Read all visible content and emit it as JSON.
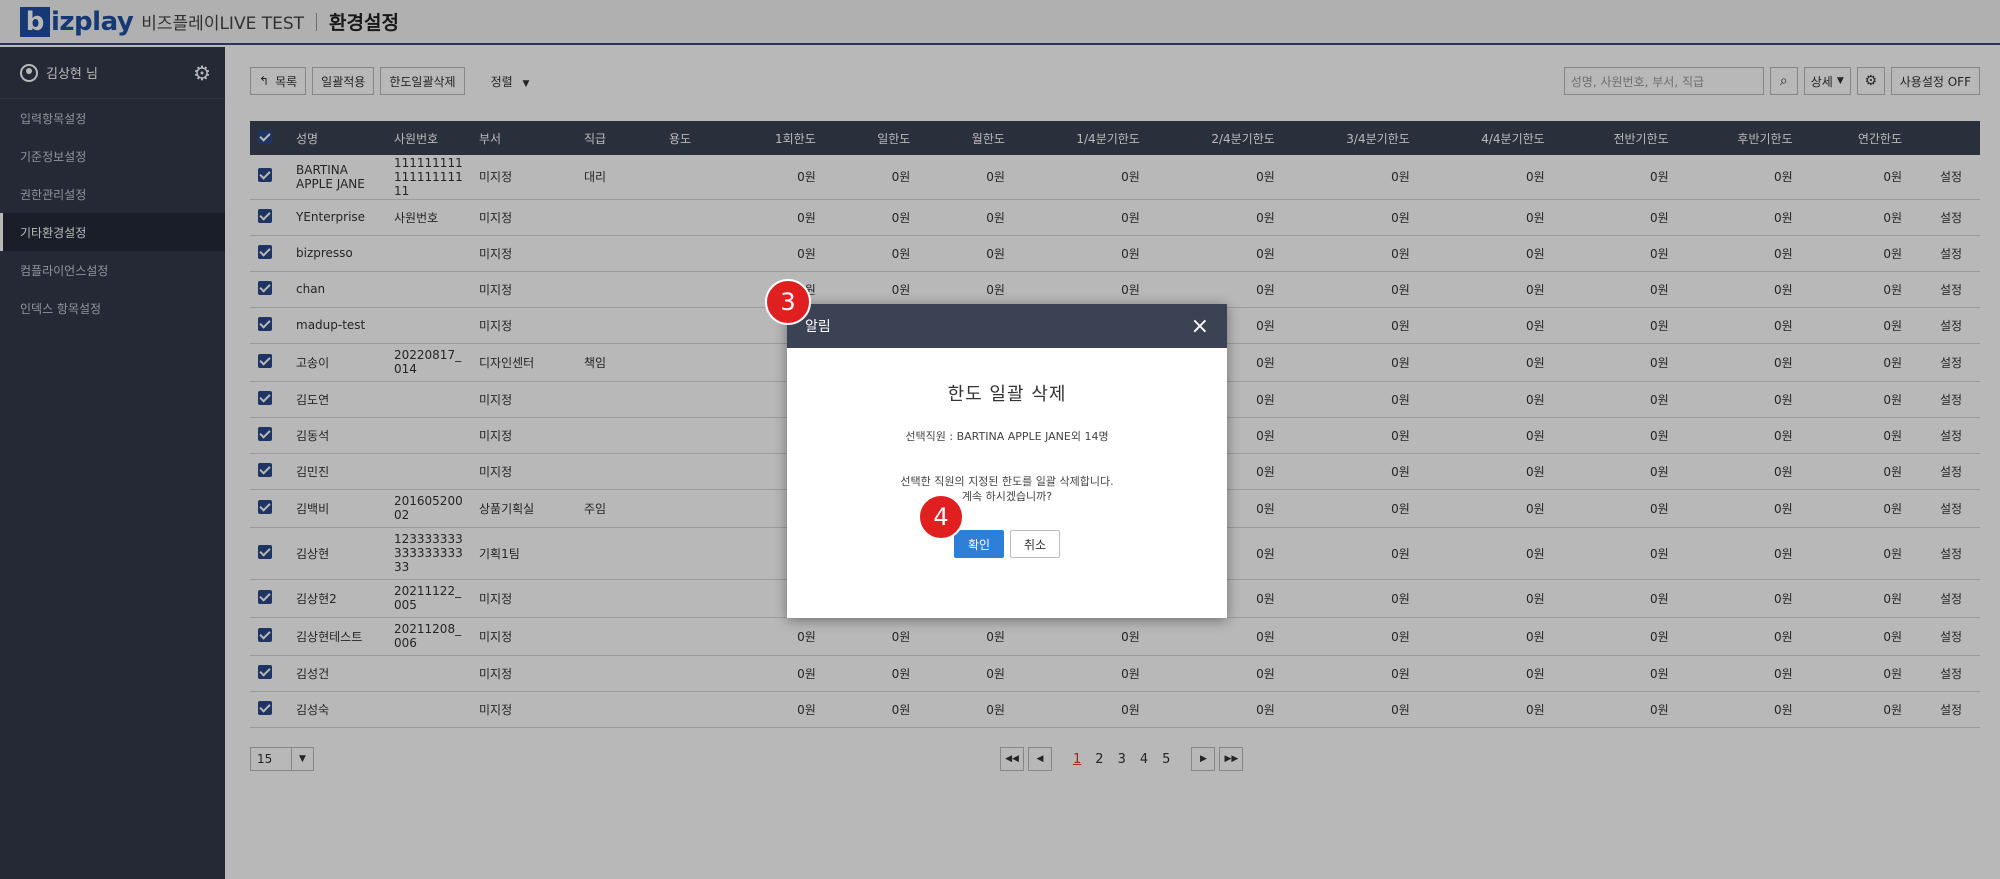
{
  "header": {
    "logo_letter": "b",
    "logo_text": "izplay",
    "brand_sub": "비즈플레이LIVE TEST",
    "page_title": "환경설정"
  },
  "sidebar": {
    "user_name": "김상현 님",
    "items": [
      {
        "label": "입력항목설정"
      },
      {
        "label": "기준정보설정"
      },
      {
        "label": "권한관리설정"
      },
      {
        "label": "기타환경설정"
      },
      {
        "label": "컴플라이언스설정"
      },
      {
        "label": "인덱스 항목설정"
      }
    ]
  },
  "toolbar": {
    "list_label": "목록",
    "apply_label": "일괄적용",
    "bulk_delete_label": "한도일괄삭제",
    "sort_label": "정렬"
  },
  "search": {
    "placeholder": "성명, 사원번호, 부서, 직급",
    "filter_value": "상세",
    "usage_toggle": "사용설정 OFF"
  },
  "table": {
    "columns": [
      "성명",
      "사원번호",
      "부서",
      "직급",
      "용도",
      "1회한도",
      "일한도",
      "월한도",
      "1/4분기한도",
      "2/4분기한도",
      "3/4분기한도",
      "4/4분기한도",
      "전반기한도",
      "후반기한도",
      "연간한도"
    ],
    "rows": [
      {
        "name": "BARTINA APPLE JANE",
        "emp": "111111111 111111111 11",
        "dept": "미지정",
        "rank": "대리",
        "setting": "설정"
      },
      {
        "name": "YEnterprise",
        "emp": "사원번호",
        "dept": "미지정",
        "rank": "",
        "setting": "설정"
      },
      {
        "name": "bizpresso",
        "emp": "",
        "dept": "미지정",
        "rank": "",
        "setting": "설정"
      },
      {
        "name": "chan",
        "emp": "",
        "dept": "미지정",
        "rank": "",
        "setting": "설정"
      },
      {
        "name": "madup-test",
        "emp": "",
        "dept": "미지정",
        "rank": "",
        "setting": "설정"
      },
      {
        "name": "고송이",
        "emp": "20220817_ 014",
        "dept": "디자인센터",
        "rank": "책임",
        "setting": "설정"
      },
      {
        "name": "김도연",
        "emp": "",
        "dept": "미지정",
        "rank": "",
        "setting": "설정"
      },
      {
        "name": "김동석",
        "emp": "",
        "dept": "미지정",
        "rank": "",
        "setting": "설정"
      },
      {
        "name": "김민진",
        "emp": "",
        "dept": "미지정",
        "rank": "",
        "setting": "설정"
      },
      {
        "name": "김백비",
        "emp": "201605200 02",
        "dept": "상품기획실",
        "rank": "주임",
        "setting": "설정"
      },
      {
        "name": "김상현",
        "emp": "123333333 333333333 33",
        "dept": "기획1팀",
        "rank": "",
        "setting": "설정"
      },
      {
        "name": "김상현2",
        "emp": "20211122_ 005",
        "dept": "미지정",
        "rank": "",
        "setting": "설정"
      },
      {
        "name": "김상현테스트",
        "emp": "20211208_ 006",
        "dept": "미지정",
        "rank": "",
        "setting": "설정"
      },
      {
        "name": "김성건",
        "emp": "",
        "dept": "미지정",
        "rank": "",
        "setting": "설정"
      },
      {
        "name": "김성숙",
        "emp": "",
        "dept": "미지정",
        "rank": "",
        "setting": "설정"
      }
    ],
    "limit_value": "0원"
  },
  "pagination": {
    "page_size": "15",
    "pages": [
      "1",
      "2",
      "3",
      "4",
      "5"
    ],
    "current": "1"
  },
  "modal": {
    "header": "알림",
    "title": "한도 일괄 삭제",
    "selected": "선택직원 : BARTINA APPLE JANE외 14명",
    "message_line1": "선택한 직원의 지정된 한도를 일괄 삭제합니다.",
    "message_line2": "계속 하시겠습니까?",
    "confirm_label": "확인",
    "cancel_label": "취소"
  },
  "steps": {
    "step3": "3",
    "step4": "4"
  }
}
